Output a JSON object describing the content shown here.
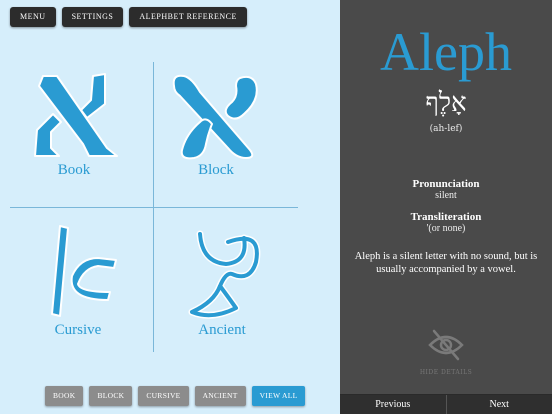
{
  "topbar": {
    "menu": "MENU",
    "settings": "SETTINGS",
    "reference": "ALEPHBET REFERENCE"
  },
  "quadrants": {
    "book": "Book",
    "block": "Block",
    "cursive": "Cursive",
    "ancient": "Ancient"
  },
  "filters": [
    "BOOK",
    "BLOCK",
    "CURSIVE",
    "ANCIENT",
    "VIEW ALL"
  ],
  "filter_active": "VIEW ALL",
  "detail": {
    "name": "Aleph",
    "hebrew": "אָלֶף",
    "pronunciation_short": "(ah-lef)",
    "pronunciation_title": "Pronunciation",
    "pronunciation_value": "silent",
    "transliteration_title": "Transliteration",
    "transliteration_value": "'(or none)",
    "description": "Aleph is a silent letter with no sound, but is usually accompanied by a vowel.",
    "hide_details": "HIDE DETAILS",
    "prev": "Previous",
    "next": "Next"
  },
  "colors": {
    "accent": "#2a9bd2",
    "panel": "#4a4a4a",
    "bg": "#d6eefb"
  },
  "icons": {
    "hide": "eye-slash-icon"
  }
}
